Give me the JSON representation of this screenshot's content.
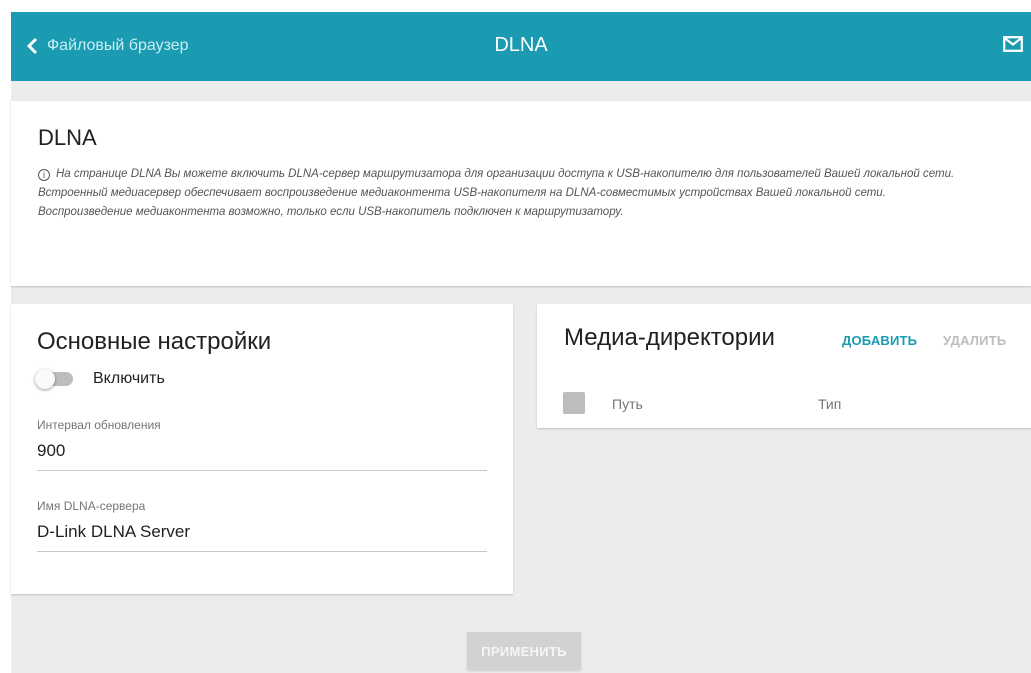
{
  "header": {
    "back_label": "Файловый браузер",
    "title": "DLNA"
  },
  "info": {
    "title": "DLNA",
    "lines": [
      "На странице DLNA Вы можете включить DLNA-сервер маршрутизатора для организации доступа к USB-накопителю для пользователей Вашей локальной сети.",
      "Встроенный медиасервер обеспечивает воспроизведение медиаконтента USB-накопителя на DLNA-совместимых устройствах Вашей локальной сети.",
      "Воспроизведение медиаконтента возможно, только если USB-накопитель подключен к маршрутизатору."
    ]
  },
  "settings": {
    "title": "Основные настройки",
    "enable_label": "Включить",
    "enabled": false,
    "interval_label": "Интервал обновления",
    "interval_value": "900",
    "server_name_label": "Имя DLNA-сервера",
    "server_name_value": "D-Link DLNA Server"
  },
  "media": {
    "title": "Медиа-директории",
    "add_label": "ДОБАВИТЬ",
    "delete_label": "УДАЛИТЬ",
    "columns": [
      "Путь",
      "Тип"
    ]
  },
  "apply_label": "ПРИМЕНИТЬ",
  "colors": {
    "header_bg": "#1a9bb1",
    "accent": "#1a9bb1",
    "disabled": "#bdbdbd"
  },
  "icons": {
    "back": "chevron-left-icon",
    "mail": "mail-icon",
    "info": "info-icon"
  }
}
